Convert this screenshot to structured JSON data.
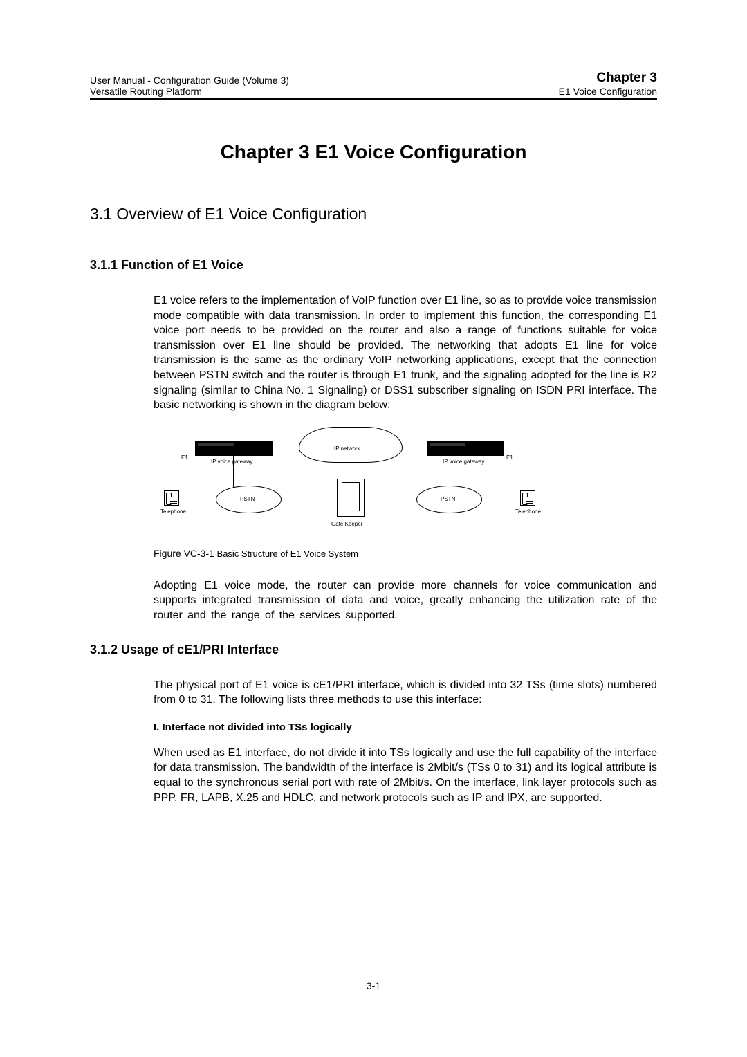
{
  "header": {
    "left_line1": "User Manual - Configuration Guide (Volume 3)",
    "left_line2": "Versatile Routing Platform",
    "right_line1": "Chapter 3",
    "right_line2": "E1 Voice Configuration"
  },
  "chapter_title": "Chapter 3  E1 Voice Configuration",
  "section_3_1": "3.1  Overview of E1 Voice Configuration",
  "section_3_1_1": "3.1.1  Function of  E1 Voice",
  "para1": "E1 voice refers to the implementation of VoIP function over E1 line, so as to provide voice transmission mode compatible with data transmission. In order to implement this function, the corresponding E1 voice port needs to be provided on the router and also a range of functions suitable for voice transmission over E1 line should be provided. The networking that adopts E1 line for voice transmission is the same as the ordinary VoIP networking applications, except that the connection between PSTN switch and the router is through E1 trunk, and the signaling adopted for the line is R2 signaling (similar to China No. 1 Signaling) or DSS1 subscriber signaling on ISDN PRI interface.  The basic networking is shown in the diagram below:",
  "diagram": {
    "ip_network": "IP network",
    "ip_voice_gateway": "IP voice gateway",
    "pstn": "PSTN",
    "e1": "E1",
    "telephone": "Telephone",
    "gate_keeper": "Gate Keeper"
  },
  "figure_caption_label": "Figure VC-3-1",
  "figure_caption_text": "  Basic Structure of E1 Voice System",
  "para2": "Adopting E1 voice mode, the router can provide more channels for voice communication and supports integrated transmission of data and voice, greatly enhancing the utilization rate of the router and the range of the services supported.",
  "section_3_1_2": "3.1.2  Usage of  cE1/PRI Interface",
  "para3": "The physical port of E1 voice is cE1/PRI interface, which is divided into 32 TSs (time slots) numbered from 0 to 31. The following lists three methods to use this interface:",
  "sub_I": "I. Interface not divided into TSs logically",
  "para4": "When used as E1 interface, do not divide it into TSs logically and use the full capability of the interface for data transmission. The bandwidth of the interface is 2Mbit/s (TSs 0 to 31) and its logical attribute is equal to the synchronous serial port with rate of 2Mbit/s. On the interface, link layer protocols such as PPP, FR, LAPB, X.25 and HDLC, and network protocols such as IP and IPX, are supported.",
  "page_number": "3-1"
}
